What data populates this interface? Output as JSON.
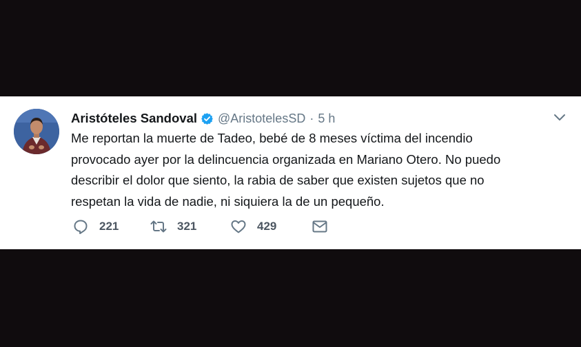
{
  "tweet": {
    "display_name": "Aristóteles Sandoval",
    "handle": "@AristotelesSD",
    "separator": "·",
    "time": "5 h",
    "verified": true,
    "text_lines": [
      "Me reportan la muerte de Tadeo, bebé de 8 meses víctima del incendio",
      "provocado ayer por la delincuencia organizada en Mariano Otero. No puedo",
      "describir el dolor que siento, la rabia de saber que existen sujetos que no",
      "respetan la vida de nadie, ni siquiera la de un pequeño."
    ],
    "actions": {
      "reply_count": "221",
      "retweet_count": "321",
      "like_count": "429"
    }
  },
  "colors": {
    "verified": "#1da1f2",
    "secondary_text": "#657786",
    "primary_text": "#14171a",
    "action_icon": "#657786",
    "frame_background": "#100c0e"
  },
  "icons": {
    "menu": "chevron-down-icon",
    "reply": "reply-icon",
    "retweet": "retweet-icon",
    "like": "heart-icon",
    "message": "envelope-icon"
  }
}
